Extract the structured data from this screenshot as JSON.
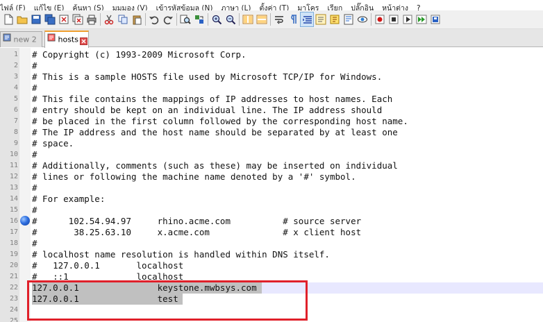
{
  "menu": [
    "ไฟล์ (F)",
    "แก้ไข (E)",
    "ค้นหา (S)",
    "มุมมอง (V)",
    "เข้ารหัสข้อมูล (N)",
    "ภาษา (L)",
    "ตั้งค่า (T)",
    "มาโคร",
    "เรียก",
    "ปลั๊กอิน",
    "หน้าต่าง",
    "?"
  ],
  "toolbar_icons": [
    "new-file",
    "open-file",
    "save",
    "save-all",
    "close",
    "close-all",
    "print",
    "cut",
    "copy",
    "paste",
    "undo",
    "redo",
    "find",
    "replace",
    "zoom-in",
    "zoom-out",
    "sync-vertical",
    "sync-horizontal",
    "word-wrap",
    "show-all-chars",
    "indent-guide",
    "function-list",
    "folder-as-workspace",
    "document-map",
    "monitor",
    "record-macro",
    "stop-recording",
    "playback-macro",
    "run-macro-multiple",
    "save-macro"
  ],
  "tabs": [
    {
      "label": "new 2",
      "active": false
    },
    {
      "label": "hosts",
      "active": true
    }
  ],
  "editor": {
    "lines": [
      {
        "num": "1",
        "text": "# Copyright (c) 1993-2009 Microsoft Corp."
      },
      {
        "num": "2",
        "text": "#"
      },
      {
        "num": "3",
        "text": "# This is a sample HOSTS file used by Microsoft TCP/IP for Windows."
      },
      {
        "num": "4",
        "text": "#"
      },
      {
        "num": "5",
        "text": "# This file contains the mappings of IP addresses to host names. Each"
      },
      {
        "num": "6",
        "text": "# entry should be kept on an individual line. The IP address should"
      },
      {
        "num": "7",
        "text": "# be placed in the first column followed by the corresponding host name."
      },
      {
        "num": "8",
        "text": "# The IP address and the host name should be separated by at least one"
      },
      {
        "num": "9",
        "text": "# space."
      },
      {
        "num": "10",
        "text": "#"
      },
      {
        "num": "11",
        "text": "# Additionally, comments (such as these) may be inserted on individual"
      },
      {
        "num": "12",
        "text": "# lines or following the machine name denoted by a '#' symbol."
      },
      {
        "num": "13",
        "text": "#"
      },
      {
        "num": "14",
        "text": "# For example:"
      },
      {
        "num": "15",
        "text": "#"
      },
      {
        "num": "16",
        "text": "#      102.54.94.97     rhino.acme.com          # source server"
      },
      {
        "num": "17",
        "text": "#       38.25.63.10     x.acme.com              # x client host"
      },
      {
        "num": "18",
        "text": "#"
      },
      {
        "num": "19",
        "text": "# localhost name resolution is handled within DNS itself."
      },
      {
        "num": "20",
        "text": "#   127.0.0.1       localhost"
      },
      {
        "num": "21",
        "text": "#   ::1             localhost"
      },
      {
        "num": "22",
        "text": "127.0.0.1               keystone.mwbsys.com"
      },
      {
        "num": "23",
        "text": "127.0.0.1               test"
      },
      {
        "num": "24",
        "text": ""
      },
      {
        "num": "25",
        "text": ""
      }
    ],
    "current_line": "22",
    "selected_lines": [
      "22",
      "23"
    ],
    "bookmarked_line": "16"
  },
  "colors": {
    "tab_active_accent": "#f0a030",
    "selection": "#c0c0c0",
    "current_line": "#e8e8ff",
    "annotation_box": "#e0202a",
    "bookmark": "#2f6fe0"
  }
}
